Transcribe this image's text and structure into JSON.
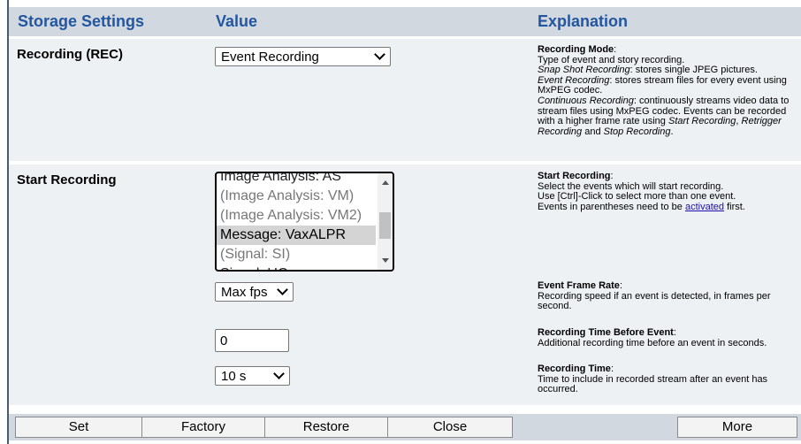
{
  "header": {
    "col1": "Storage Settings",
    "col2": "Value",
    "col3": "Explanation"
  },
  "recording": {
    "label": "Recording (REC)",
    "mode_value": "Event Recording",
    "expl_title": "Recording Mode",
    "expl_lines": [
      "Type of event and story recording.",
      "stores single JPEG pictures.",
      "stores stream files for every event using MxPEG codec.",
      "continuously streams video data to stream files using MxPEG codec. Events can be recorded with a higher frame rate using"
    ],
    "snap_label": "Snap Shot Recording",
    "event_label": "Event Recording",
    "continuous_label": "Continuous Recording",
    "start_label": "Start Recording",
    "retrigger_label": "Retrigger Recording",
    "and": "and",
    "stop_label": "Stop Recording"
  },
  "start": {
    "label": "Start Recording",
    "options": [
      {
        "text": "Image Analysis: AS",
        "enabled": true,
        "selected": false
      },
      {
        "text": "(Image Analysis: VM)",
        "enabled": false,
        "selected": false
      },
      {
        "text": "(Image Analysis: VM2)",
        "enabled": false,
        "selected": false
      },
      {
        "text": "Message: VaxALPR",
        "enabled": true,
        "selected": true
      },
      {
        "text": "(Signal: SI)",
        "enabled": false,
        "selected": false
      },
      {
        "text": "Signal: UC",
        "enabled": true,
        "selected": false
      }
    ],
    "expl_title": "Start Recording",
    "expl_line1": "Select the events which will start recording.",
    "expl_line2": "Use [Ctrl]-Click to select more than one event.",
    "expl_line3a": "Events in parentheses need to be",
    "expl_link": "activated",
    "expl_line3b": "first."
  },
  "frame_rate": {
    "value": "Max fps",
    "expl_title": "Event Frame Rate",
    "expl_text": "Recording speed if an event is detected, in frames per second."
  },
  "before_event": {
    "value": "0",
    "expl_title": "Recording Time Before Event",
    "expl_text": "Additional recording time before an event in seconds."
  },
  "rec_time": {
    "value": "10 s",
    "expl_title": "Recording Time",
    "expl_text": "Time to include in recorded stream after an event has occurred."
  },
  "footer": {
    "set": "Set",
    "factory": "Factory",
    "restore": "Restore",
    "close": "Close",
    "more": "More"
  },
  "colors": {
    "header_bg": "#d2d8df",
    "header_text": "#2256a0",
    "row_bg": "#eef1f4",
    "link": "#1a0dab"
  }
}
